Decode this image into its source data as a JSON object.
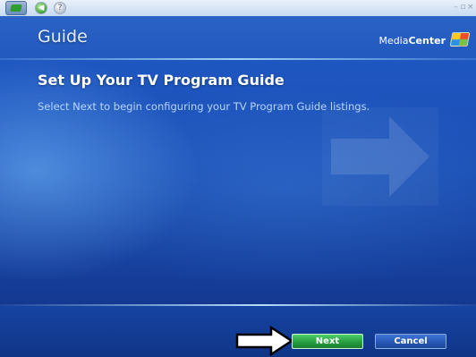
{
  "window": {
    "controls": [
      "–",
      "▫",
      "×"
    ]
  },
  "toolbar": {
    "logo_icon": "media-center-start-icon",
    "back_icon": "back-arrow-icon",
    "help_icon": "help-icon"
  },
  "header": {
    "title": "Guide",
    "brand_prefix": "Media",
    "brand_suffix": "Center",
    "brand_logo_icon": "windows-flag-icon"
  },
  "main": {
    "heading": "Set Up Your TV Program Guide",
    "instruction": "Select Next to begin configuring your TV Program Guide listings."
  },
  "footer": {
    "next_label": "Next",
    "cancel_label": "Cancel"
  },
  "colors": {
    "background": "#1b4fb5",
    "next_button": "#249a3c",
    "cancel_button": "#2556b4",
    "instruction_text": "#b9d4ff"
  }
}
